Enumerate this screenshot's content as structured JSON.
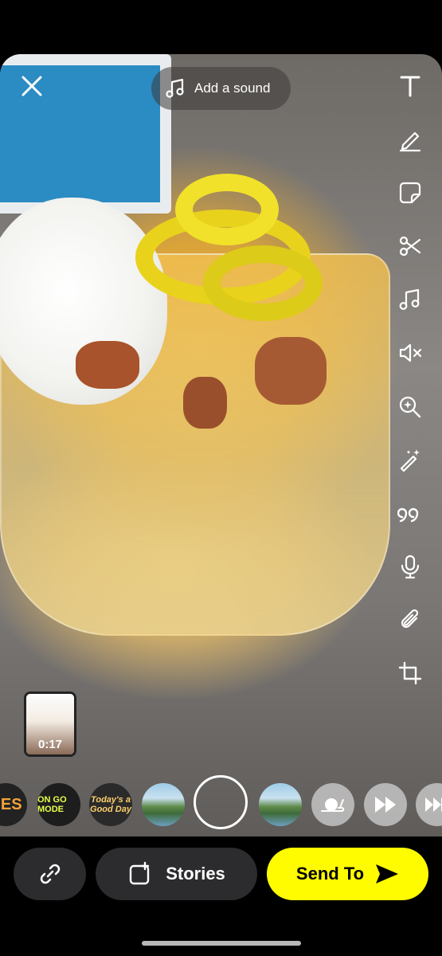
{
  "top": {
    "sound_label": "Add a sound"
  },
  "tools": [
    {
      "name": "text-tool",
      "icon": "text-icon"
    },
    {
      "name": "draw-tool",
      "icon": "pencil-icon"
    },
    {
      "name": "sticker-tool",
      "icon": "sticker-icon"
    },
    {
      "name": "scissors-tool",
      "icon": "scissors-icon"
    },
    {
      "name": "music-tool",
      "icon": "music-note-icon"
    },
    {
      "name": "mute-tool",
      "icon": "speaker-mute-icon"
    },
    {
      "name": "lens-search-tool",
      "icon": "search-sparkle-icon"
    },
    {
      "name": "magic-tool",
      "icon": "magic-wand-icon"
    },
    {
      "name": "quote-tool",
      "icon": "quote-icon"
    },
    {
      "name": "voice-tool",
      "icon": "microphone-icon"
    },
    {
      "name": "attach-tool",
      "icon": "paperclip-icon"
    },
    {
      "name": "crop-tool",
      "icon": "crop-icon"
    }
  ],
  "clip": {
    "duration": "0:17"
  },
  "lenses": [
    {
      "label": "BES"
    },
    {
      "label": "ON GO MODE"
    },
    {
      "label": "Today's a Good Day"
    }
  ],
  "bottom": {
    "stories_label": "Stories",
    "send_label": "Send To"
  },
  "colors": {
    "send_button": "#fffc00",
    "pill_background": "#2c2c2e"
  }
}
